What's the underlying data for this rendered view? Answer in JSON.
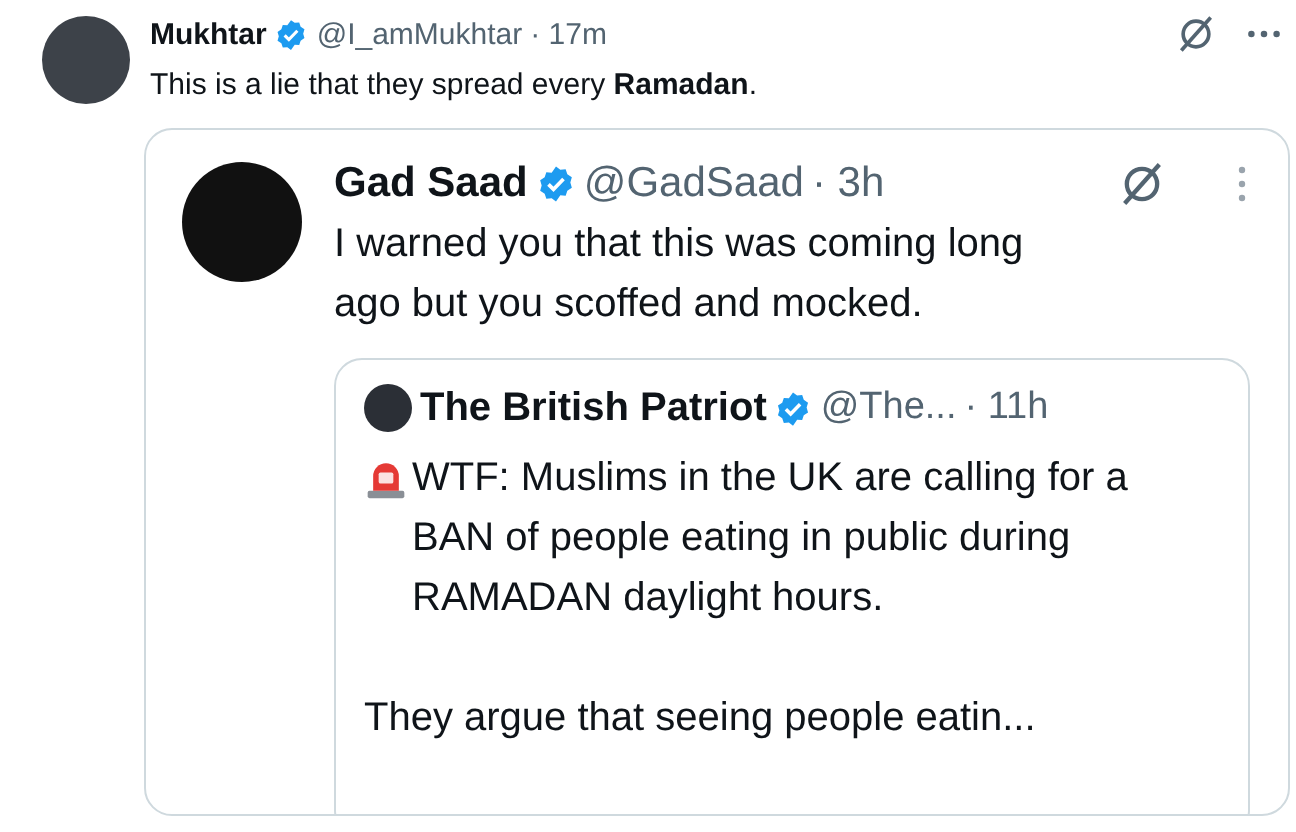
{
  "post": {
    "name": "Mukhtar",
    "verified": true,
    "handle": "@I_amMukhtar",
    "time": "· 17m",
    "text": "This is a lie that they spread every **Ramadan**.",
    "quote": {
      "name": "Gad Saad",
      "verified": true,
      "handle": "@GadSaad",
      "time": "· 3h",
      "text": "I warned you that this was coming long ago but you scoffed and mocked.",
      "quote": {
        "name": "The British Patriot",
        "verified": true,
        "handle": "@The...",
        "time": "· 11h",
        "paragraphs": [
          "WTF: Muslims in the UK are calling for a BAN of people eating in public during RAMADAN daylight hours.",
          "They argue that seeing people eatin..."
        ]
      }
    }
  }
}
